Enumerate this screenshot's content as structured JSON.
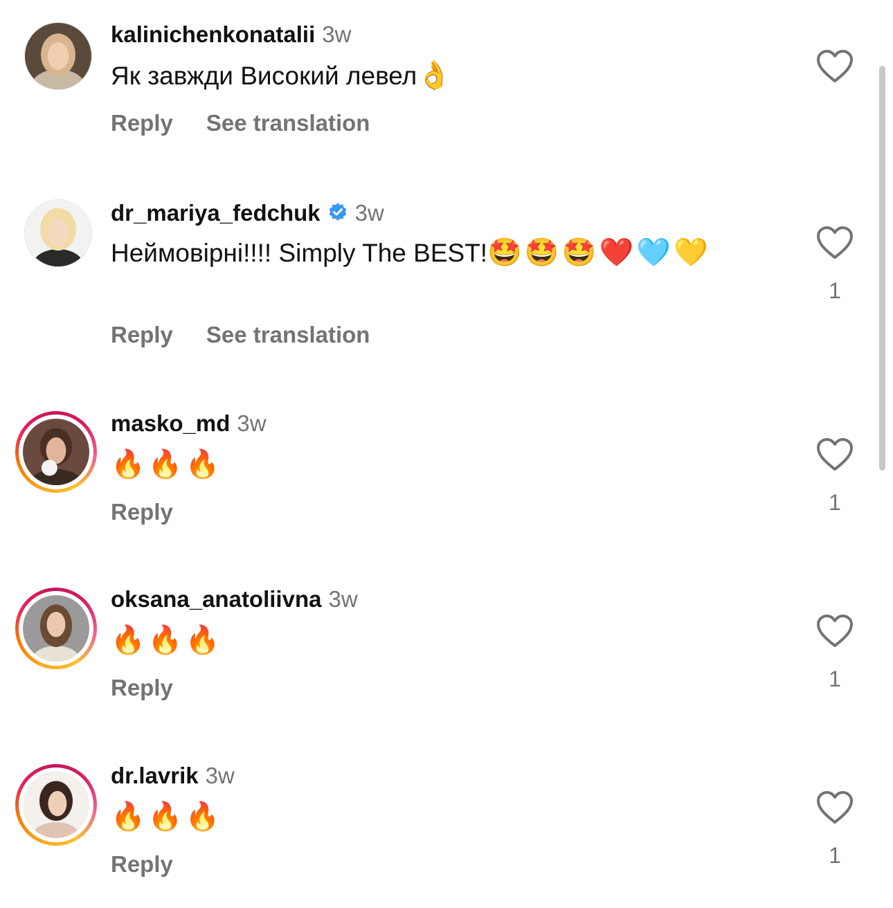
{
  "comments": [
    {
      "username": "kalinichenkonatalii",
      "time": "3w",
      "text": "Як завжди Високий левел",
      "emoji": "👌",
      "reply_label": "Reply",
      "translate_label": "See translation",
      "likes": ""
    },
    {
      "username": "dr_mariya_fedchuk",
      "verified": true,
      "time": "3w",
      "text": "Неймовірні!!!! Simply The BEST!",
      "emoji": "🤩🤩🤩❤️🩵💛",
      "reply_label": "Reply",
      "translate_label": "See translation",
      "likes": "1"
    },
    {
      "username": "masko_md",
      "time": "3w",
      "text": "",
      "emoji": "🔥🔥🔥",
      "reply_label": "Reply",
      "likes": "1"
    },
    {
      "username": "oksana_anatoliivna",
      "time": "3w",
      "text": "",
      "emoji": "🔥🔥🔥",
      "reply_label": "Reply",
      "likes": "1"
    },
    {
      "username": "dr.lavrik",
      "time": "3w",
      "text": "",
      "emoji": "🔥🔥🔥",
      "reply_label": "Reply",
      "likes": "1"
    }
  ],
  "icons": {
    "like": "heart-outline-icon",
    "verified": "verified-badge-icon"
  },
  "colors": {
    "verified": "#3897f0",
    "secondary_text": "#737373",
    "story_ring_start": "#f9a825",
    "story_ring_end": "#d81b60"
  }
}
